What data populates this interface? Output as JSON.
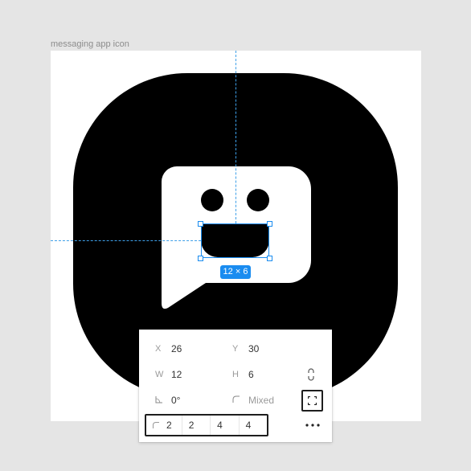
{
  "canvas": {
    "frame_label": "messaging app icon",
    "selection_size": "12 × 6"
  },
  "panel": {
    "x_label": "X",
    "x_value": "26",
    "y_label": "Y",
    "y_value": "30",
    "w_label": "W",
    "w_value": "12",
    "h_label": "H",
    "h_value": "6",
    "rotation_value": "0°",
    "corner_radius_value": "Mixed",
    "radii": [
      "2",
      "2",
      "4",
      "4"
    ]
  },
  "icons": [
    "constrain-proportions-icon",
    "rotation-icon",
    "corner-radius-icon",
    "independent-corners-icon",
    "more-icon"
  ],
  "colors": {
    "selection": "#1a8cf0",
    "guide": "#3fa0e8",
    "icon_fill": "#000000",
    "canvas_bg": "#e5e5e5"
  }
}
